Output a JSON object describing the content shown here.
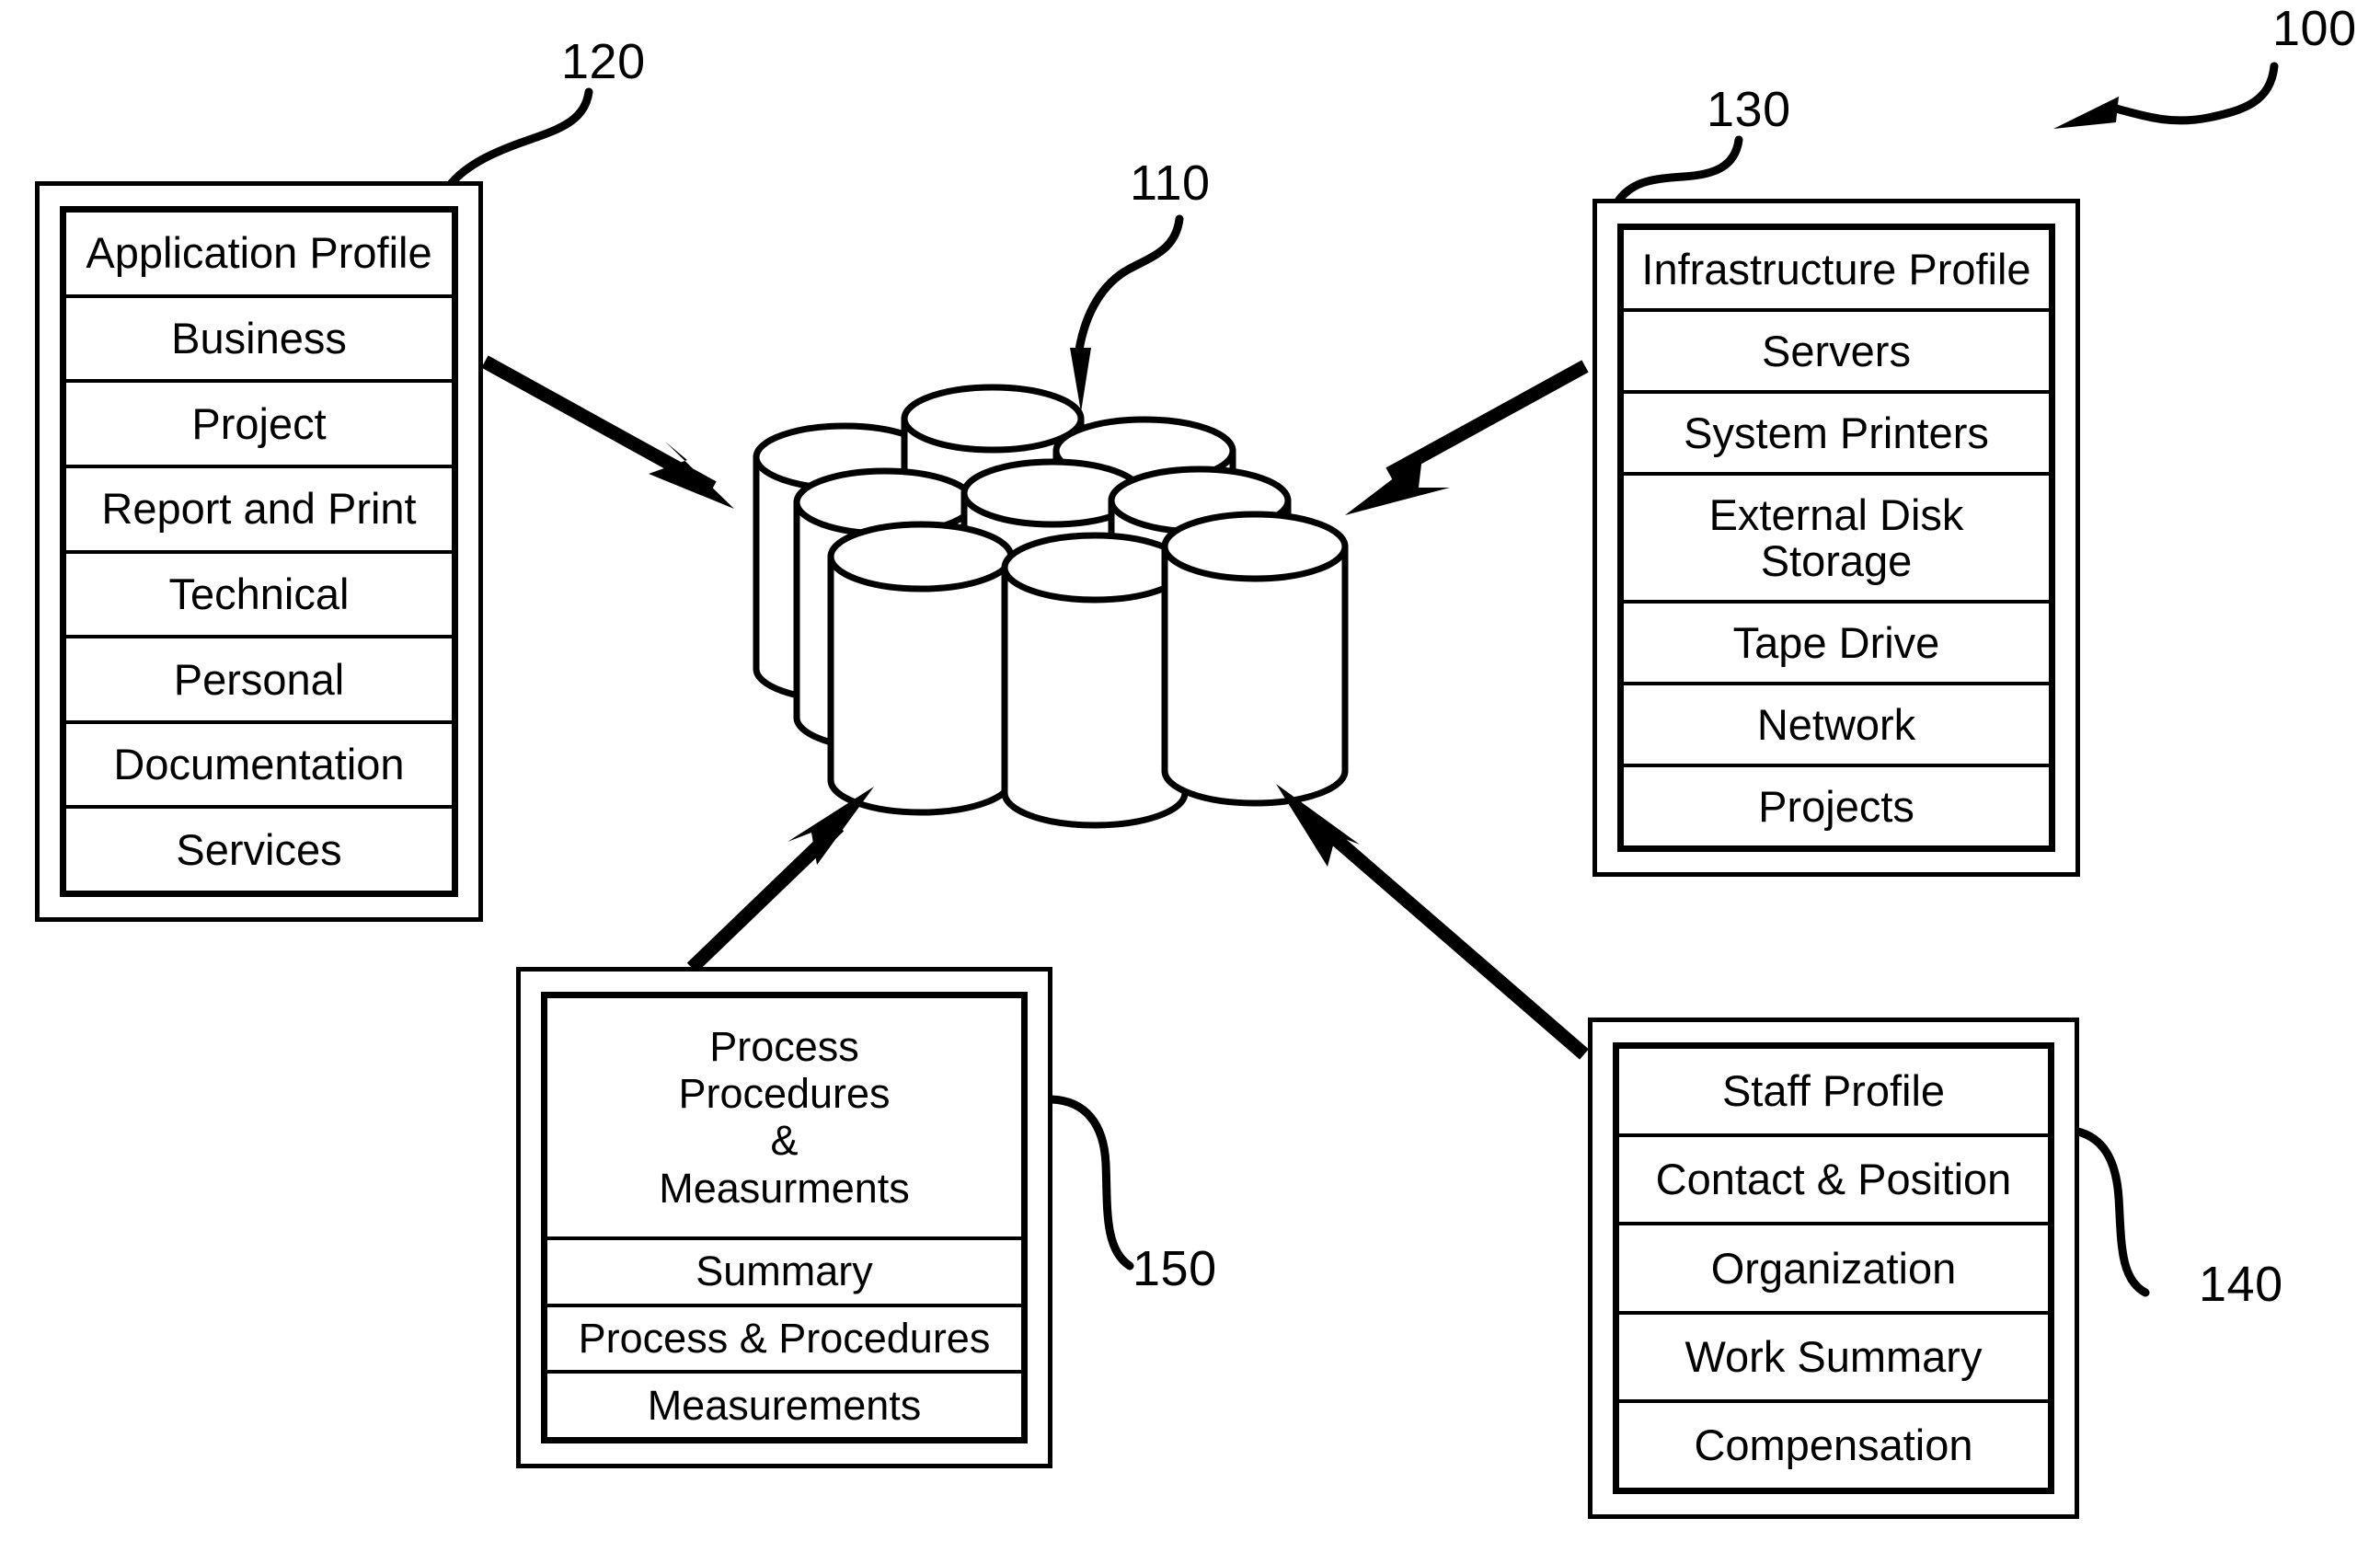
{
  "figure": {
    "title": "System architecture block diagram",
    "background_color": "#ffffff",
    "line_color": "#000000"
  },
  "reference_numerals": {
    "system": "100",
    "repository": "110",
    "application_profile": "120",
    "infrastructure_profile": "130",
    "staff_profile": "140",
    "process_procedures": "150"
  },
  "boxes": {
    "box_120": {
      "ref": "120",
      "rows": [
        "Application Profile",
        "Business",
        "Project",
        "Report and Print",
        "Technical",
        "Personal",
        "Documentation",
        "Services"
      ]
    },
    "box_130": {
      "ref": "130",
      "rows": [
        "Infrastructure Profile",
        "Servers",
        "System Printers",
        "External Disk Storage",
        "Tape Drive",
        "Network",
        "Projects"
      ]
    },
    "box_150": {
      "ref": "150",
      "rows": [
        "Process\nProcedures\n&\nMeasurments",
        "Summary",
        "Process & Procedures",
        "Measurements"
      ]
    },
    "box_140": {
      "ref": "140",
      "rows": [
        "Staff Profile",
        "Contact & Position",
        "Organization",
        "Work Summary",
        "Compensation"
      ]
    }
  },
  "repository": {
    "ref": "110",
    "icon": "database-cylinder-cluster",
    "cylinder_count": 9
  },
  "connectors": [
    {
      "name": "application-profile-to-repository",
      "from": "120",
      "to": "110",
      "style": "solid-thick-arrow"
    },
    {
      "name": "infrastructure-profile-to-repository",
      "from": "130",
      "to": "110",
      "style": "solid-thick-arrow"
    },
    {
      "name": "process-procedures-to-repository",
      "from": "150",
      "to": "110",
      "style": "solid-thick-arrow"
    },
    {
      "name": "staff-profile-to-repository",
      "from": "140",
      "to": "110",
      "style": "solid-thick-arrow"
    }
  ]
}
